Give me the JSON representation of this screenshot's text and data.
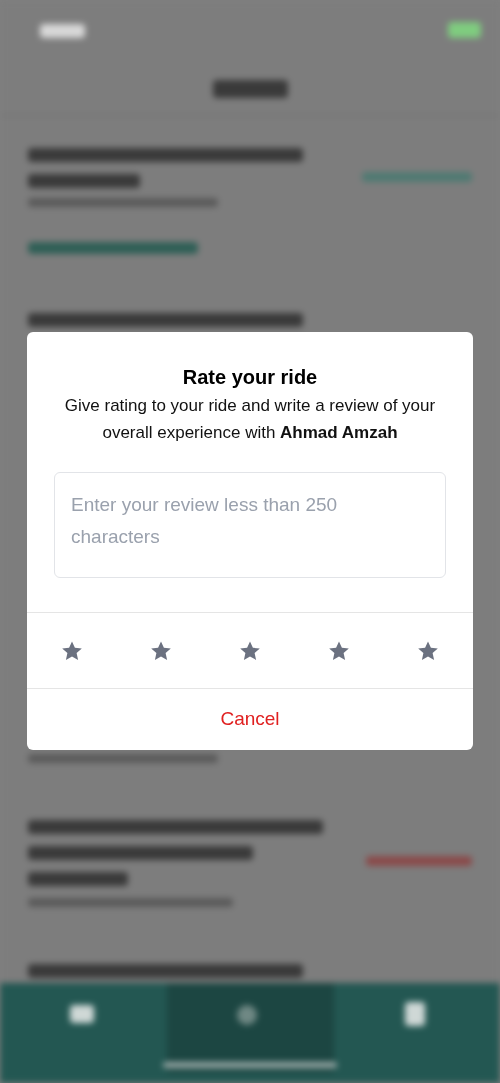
{
  "dialog": {
    "title": "Rate your ride",
    "message": "Give rating to your ride and write a review of your overall experience with **Ahmad Amzah**",
    "review_field": {
      "placeholder": "Enter your review less than 250 characters"
    },
    "rating_stars": [
      {
        "selected": false
      },
      {
        "selected": false
      },
      {
        "selected": false
      },
      {
        "selected": false
      },
      {
        "selected": false
      }
    ],
    "cancel_button": "Cancel"
  }
}
